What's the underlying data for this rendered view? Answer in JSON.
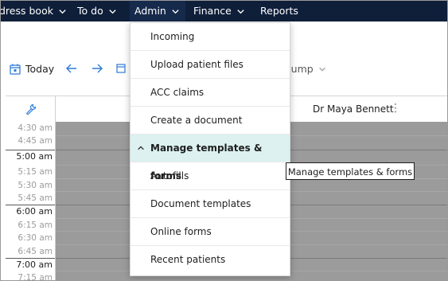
{
  "nav": {
    "items": [
      {
        "label": "dress book",
        "has_chevron": true
      },
      {
        "label": "To do",
        "has_chevron": true
      },
      {
        "label": "Admin",
        "has_chevron": true
      },
      {
        "label": "Finance",
        "has_chevron": true
      },
      {
        "label": "Reports",
        "has_chevron": false
      }
    ]
  },
  "toolbar": {
    "today_label": "Today",
    "jump_label": "Jump"
  },
  "schedule": {
    "provider_name": "Dr Maya Bennett",
    "times": [
      {
        "label": "4:30 am",
        "hour": false
      },
      {
        "label": "4:45 am",
        "hour": false
      },
      {
        "label": "5:00 am",
        "hour": true
      },
      {
        "label": "5:15 am",
        "hour": false
      },
      {
        "label": "5:30 am",
        "hour": false
      },
      {
        "label": "5:45 am",
        "hour": false
      },
      {
        "label": "6:00 am",
        "hour": true
      },
      {
        "label": "6:15 am",
        "hour": false
      },
      {
        "label": "6:30 am",
        "hour": false
      },
      {
        "label": "6:45 am",
        "hour": false
      },
      {
        "label": "7:00 am",
        "hour": true
      },
      {
        "label": "7:15 am",
        "hour": false
      }
    ]
  },
  "admin_menu": {
    "items": [
      {
        "label": "Incoming"
      },
      {
        "label": "Upload patient files"
      },
      {
        "label": "ACC claims"
      },
      {
        "label": "Create a document"
      },
      {
        "label": "Manage templates & forms"
      },
      {
        "label": "Autofills"
      },
      {
        "label": "Document templates"
      },
      {
        "label": "Online forms"
      },
      {
        "label": "Recent patients"
      }
    ],
    "highlighted_index": 4
  },
  "tooltip": {
    "text": "Manage templates & forms"
  },
  "colors": {
    "navbar": "#0f1f3a",
    "menu_highlight": "#dcf1f0",
    "accent": "#2e7bd6",
    "grid": "#9b9b9b"
  }
}
